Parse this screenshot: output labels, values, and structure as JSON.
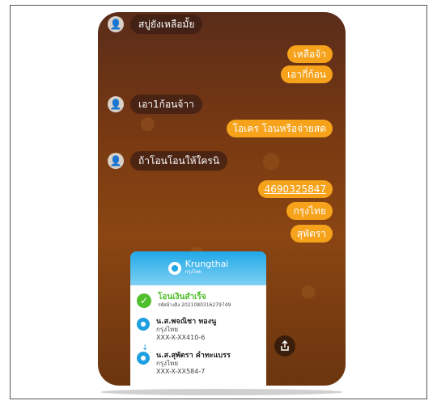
{
  "chat": {
    "msg1": "สบู่ยังเหลือมั้ย",
    "msg2": "เหลือจ้า",
    "msg3": "เอากี่ก้อน",
    "msg4": "เอา1ก้อนจ้าา",
    "msg5": "โอเคร โอนหรือจ่ายสด",
    "msg6": "ถ้าโอนโอนให้ใครนิ",
    "msg7": "4690325847",
    "msg8": "กรุงไทย",
    "msg9": "สุพัตรา"
  },
  "slip": {
    "brand": "Krungthai",
    "brand_sub": "กรุงไทย",
    "status": "โอนเงินสำเร็จ",
    "ref": "รหัสอ้างอิง 2021080316279749",
    "sender_name": "น.ส.พจณิชา ทองนู",
    "sender_bank": "กรุงไทย",
    "sender_acct": "XXX-X-XX410-6",
    "receiver_name": "น.ส.สุพัตรา คำทะแบรร",
    "receiver_bank": "กรุงไทย",
    "receiver_acct": "XXX-X-XX584-7"
  },
  "icons": {
    "avatar": "person-avatar-icon",
    "check": "check-circle-icon",
    "bank": "krungthai-bank-icon",
    "arrow": "arrow-down-icon",
    "share": "share-icon"
  }
}
